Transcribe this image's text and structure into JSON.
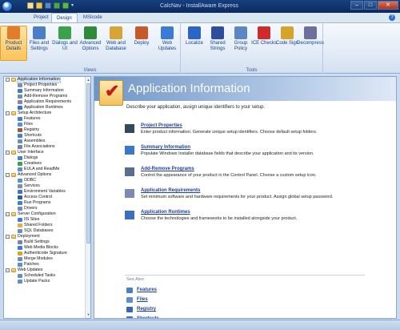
{
  "window": {
    "title": "CalcNav - InstallAware Express"
  },
  "tabs": [
    {
      "label": "Project"
    },
    {
      "label": "Design"
    },
    {
      "label": "MSIcode"
    }
  ],
  "ribbon": {
    "views_label": "Views",
    "tools_label": "Tools",
    "views": [
      {
        "label": "Product Details",
        "icon": "product-details-icon",
        "color": "#e07c2a"
      },
      {
        "label": "Files and Settings",
        "icon": "files-settings-icon",
        "color": "#4a7fc7"
      },
      {
        "label": "Dialogs and UI",
        "icon": "dialogs-ui-icon",
        "color": "#3aa24a"
      },
      {
        "label": "Advanced Options",
        "icon": "advanced-options-icon",
        "color": "#2f8a3a"
      },
      {
        "label": "Web and Database",
        "icon": "web-database-icon",
        "color": "#d8a436"
      },
      {
        "label": "Deploy",
        "icon": "deploy-icon",
        "color": "#c85a2a"
      },
      {
        "label": "Web Updates",
        "icon": "web-updates-icon",
        "color": "#3a7ad8"
      }
    ],
    "tools": [
      {
        "label": "Localize",
        "icon": "flag-icon",
        "color": "#2a66c9"
      },
      {
        "label": "Shared Strings",
        "icon": "pilcrow-icon",
        "color": "#2d4e9c"
      },
      {
        "label": "Group Policy",
        "icon": "network-icon",
        "color": "#5a86c5"
      },
      {
        "label": "ICE Checks",
        "icon": "ice-check-icon",
        "color": "#cf2b2b"
      },
      {
        "label": "Code Sign",
        "icon": "key-icon",
        "color": "#d7a429"
      },
      {
        "label": "Decompress",
        "icon": "decompress-icon",
        "color": "#6f6f9c"
      }
    ]
  },
  "tree": [
    {
      "label": "Application Information",
      "level": 0,
      "expander": "−",
      "folder": true,
      "selected": true
    },
    {
      "label": "Project Properties",
      "level": 1,
      "color": "#7b8fb7"
    },
    {
      "label": "Summary Information",
      "level": 1,
      "color": "#4b78c6"
    },
    {
      "label": "Add-Remove Programs",
      "level": 1,
      "color": "#6e8fb9"
    },
    {
      "label": "Application Requirements",
      "level": 1,
      "color": "#8a7fb9"
    },
    {
      "label": "Application Runtimes",
      "level": 1,
      "color": "#3f73c5"
    },
    {
      "label": "Setup Architecture",
      "level": 0,
      "expander": "−",
      "folder": true
    },
    {
      "label": "Features",
      "level": 1,
      "color": "#4a7fc7"
    },
    {
      "label": "Files",
      "level": 1,
      "color": "#5a8fd0"
    },
    {
      "label": "Registry",
      "level": 1,
      "color": "#9b5a3f"
    },
    {
      "label": "Shortcuts",
      "level": 1,
      "color": "#4a7fc7"
    },
    {
      "label": "Assemblies",
      "level": 1,
      "color": "#6a8fb9"
    },
    {
      "label": "File Associations",
      "level": 1,
      "color": "#7a7fb0"
    },
    {
      "label": "User Interface",
      "level": 0,
      "expander": "−",
      "folder": true
    },
    {
      "label": "Dialogs",
      "level": 1,
      "color": "#4a7fc7"
    },
    {
      "label": "Creatives",
      "level": 1,
      "color": "#3aa24a"
    },
    {
      "label": "EULA and ReadMe",
      "level": 1,
      "color": "#5a8fd0"
    },
    {
      "label": "Advanced Options",
      "level": 0,
      "expander": "−",
      "folder": true
    },
    {
      "label": "ODBC",
      "level": 1,
      "color": "#5a8fd0"
    },
    {
      "label": "Services",
      "level": 1,
      "color": "#7a8fb0"
    },
    {
      "label": "Environment Variables",
      "level": 1,
      "color": "#3f73c5"
    },
    {
      "label": "Access Control",
      "level": 1,
      "color": "#2f5f9a"
    },
    {
      "label": "Run Programs",
      "level": 1,
      "color": "#4a7fc7"
    },
    {
      "label": "Drivers",
      "level": 1,
      "color": "#6a8fb9"
    },
    {
      "label": "Server Configuration",
      "level": 0,
      "expander": "−",
      "folder": true
    },
    {
      "label": "IIS Sites",
      "level": 1,
      "color": "#3a7ad8"
    },
    {
      "label": "Shared Folders",
      "level": 1,
      "color": "#e0b04a"
    },
    {
      "label": "SQL Databases",
      "level": 1,
      "color": "#6a8fb9"
    },
    {
      "label": "Deployment",
      "level": 0,
      "expander": "−",
      "folder": true
    },
    {
      "label": "Build Settings",
      "level": 1,
      "color": "#7a7fb0"
    },
    {
      "label": "Web Media Blocks",
      "level": 1,
      "color": "#3a7ad8"
    },
    {
      "label": "Authenticode Signature",
      "level": 1,
      "color": "#d7a429"
    },
    {
      "label": "Merge Modules",
      "level": 1,
      "color": "#6a8fb9"
    },
    {
      "label": "Patches",
      "level": 1,
      "color": "#5a8fd0"
    },
    {
      "label": "Web Updates",
      "level": 0,
      "expander": "−",
      "folder": true
    },
    {
      "label": "Scheduled Tasks",
      "level": 1,
      "color": "#6a8fb9"
    },
    {
      "label": "Update Packs",
      "level": 1,
      "color": "#5a8fd0"
    }
  ],
  "content": {
    "title": "Application Information",
    "description": "Describe your application, assign unique identifiers to your setup.",
    "items": [
      {
        "title": "Project Properties",
        "desc": "Enter product information. Generate unique setup identifiers. Choose default setup folders.",
        "icon": "pen-icon",
        "color": "#34495e"
      },
      {
        "title": "Summary Information",
        "desc": "Populate Windows Installer database fields that describe your application and its version.",
        "icon": "list-icon",
        "color": "#3c78c8"
      },
      {
        "title": "Add-Remove Programs",
        "desc": "Control the appearance of your product in the Control Panel. Choose a custom setup icon.",
        "icon": "add-remove-icon",
        "color": "#5a6f8f"
      },
      {
        "title": "Application Requirements",
        "desc": "Set minimum software and hardware requirements for your product. Assign global setup password.",
        "icon": "gears-icon",
        "color": "#7c8ab5"
      },
      {
        "title": "Application Runtimes",
        "desc": "Choose the technologies and frameworks to be installed alongside your product.",
        "icon": "runtimes-icon",
        "color": "#3c6fc0"
      }
    ],
    "see_also": "See Also",
    "links": [
      {
        "label": "Features",
        "icon": "features-icon",
        "color": "#4a7fc7"
      },
      {
        "label": "Files",
        "icon": "files-icon",
        "color": "#5a8fd0"
      },
      {
        "label": "Registry",
        "icon": "registry-icon",
        "color": "#3c64b0"
      },
      {
        "label": "Shortcuts",
        "icon": "shortcuts-icon",
        "color": "#3a6fc8"
      }
    ]
  }
}
